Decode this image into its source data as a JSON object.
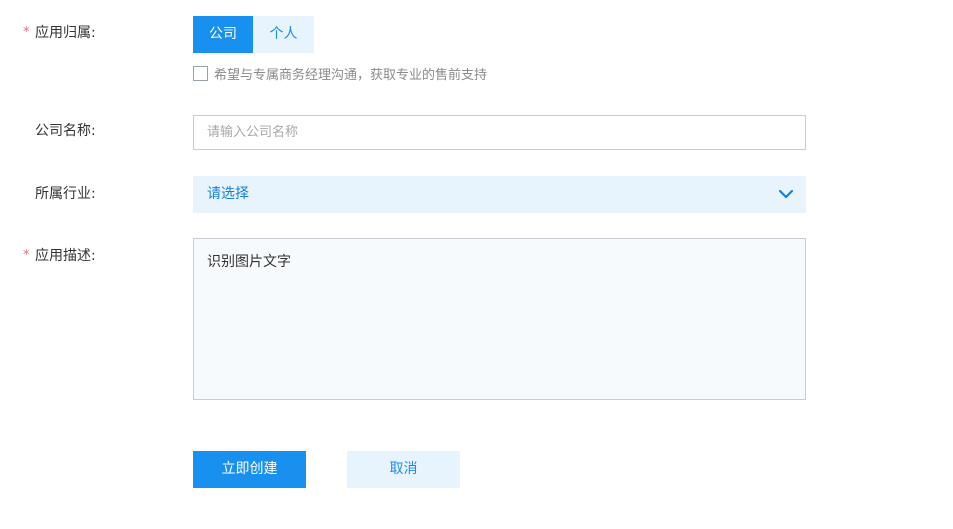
{
  "form": {
    "owner": {
      "label": "应用归属:",
      "required_mark": "*",
      "options": [
        "公司",
        "个人"
      ],
      "selected": "公司"
    },
    "contact_checkbox": {
      "checked": false,
      "label": "希望与专属商务经理沟通，获取专业的售前支持"
    },
    "company_name": {
      "label": "公司名称:",
      "placeholder": "请输入公司名称",
      "value": ""
    },
    "industry": {
      "label": "所属行业:",
      "selected_text": "请选择",
      "icon": "chevron-down-icon"
    },
    "description": {
      "label": "应用描述:",
      "required_mark": "*",
      "value": "识别图片文字"
    }
  },
  "actions": {
    "create_label": "立即创建",
    "cancel_label": "取消"
  },
  "colors": {
    "primary": "#1890ef",
    "primary_light": "#e8f4fd",
    "required": "#f56c6c",
    "select_text": "#1a7fd4"
  }
}
